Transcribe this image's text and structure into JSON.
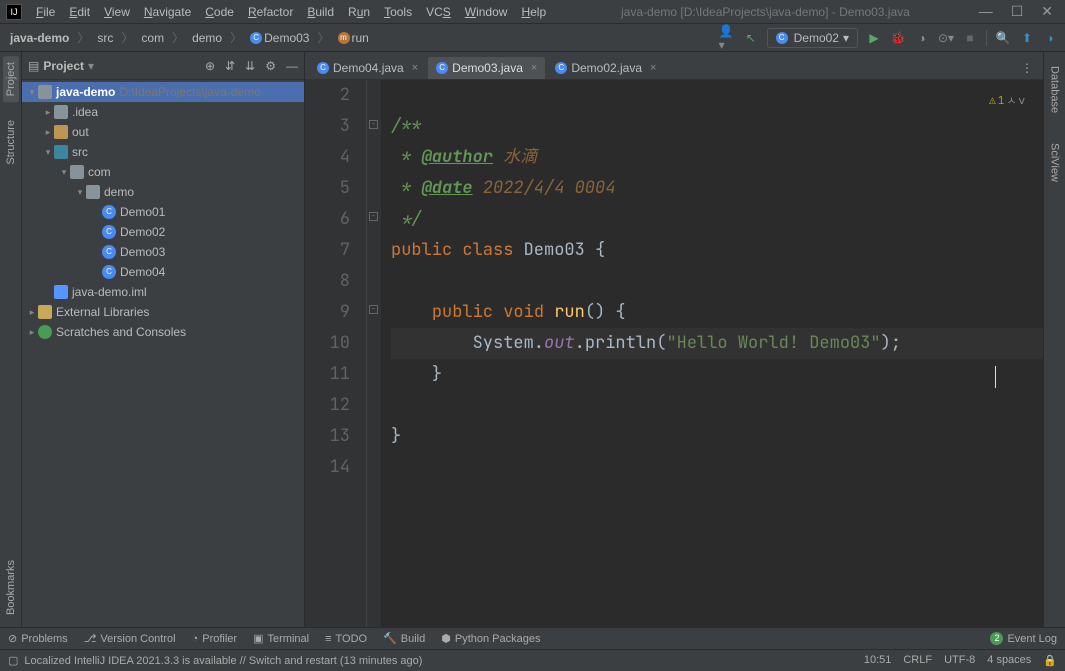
{
  "title": "java-demo [D:\\IdeaProjects\\java-demo] - Demo03.java",
  "menu": [
    "File",
    "Edit",
    "View",
    "Navigate",
    "Code",
    "Refactor",
    "Build",
    "Run",
    "Tools",
    "VCS",
    "Window",
    "Help"
  ],
  "breadcrumb": {
    "project": "java-demo",
    "p1": "src",
    "p2": "com",
    "p3": "demo",
    "cls": "Demo03",
    "method": "run"
  },
  "runConfig": "Demo02",
  "projectPanel": {
    "title": "Project",
    "rootHint": "D:\\IdeaProjects\\java-demo"
  },
  "tree": {
    "root": "java-demo",
    "idea": ".idea",
    "out": "out",
    "src": "src",
    "com": "com",
    "demo": "demo",
    "c1": "Demo01",
    "c2": "Demo02",
    "c3": "Demo03",
    "c4": "Demo04",
    "iml": "java-demo.iml",
    "libs": "External Libraries",
    "scratch": "Scratches and Consoles"
  },
  "tabs": {
    "t1": "Demo04.java",
    "t2": "Demo03.java",
    "t3": "Demo02.java"
  },
  "code": {
    "l3": "/**",
    "l4_pre": " * ",
    "l4_tag": "@author",
    "l4_val": " 水滴",
    "l5_pre": " * ",
    "l5_tag": "@date",
    "l5_val": " 2022/4/4 0004",
    "l6": " */",
    "l7_kw1": "public ",
    "l7_kw2": "class ",
    "l7_cls": "Demo03 ",
    "l7_b": "{",
    "l9_kw1": "public ",
    "l9_kw2": "void ",
    "l9_m": "run",
    "l9_p": "() {",
    "l10_a": "System.",
    "l10_b": "out",
    "l10_c": ".println(",
    "l10_s": "\"Hello World! Demo03\"",
    "l10_d": ");",
    "l11": "}",
    "l13": "}"
  },
  "lineNums": [
    "2",
    "3",
    "4",
    "5",
    "6",
    "7",
    "8",
    "9",
    "10",
    "11",
    "12",
    "13",
    "14"
  ],
  "warnCount": "1",
  "leftTabs": {
    "project": "Project",
    "structure": "Structure",
    "bookmarks": "Bookmarks"
  },
  "rightTabs": {
    "database": "Database",
    "sciview": "SciView"
  },
  "bottomTabs": {
    "problems": "Problems",
    "vcs": "Version Control",
    "profiler": "Profiler",
    "terminal": "Terminal",
    "todo": "TODO",
    "build": "Build",
    "python": "Python Packages",
    "eventLog": "Event Log",
    "eventBadge": "2"
  },
  "status": {
    "msg": "Localized IntelliJ IDEA 2021.3.3 is available // Switch and restart (13 minutes ago)",
    "time": "10:51",
    "eol": "CRLF",
    "enc": "UTF-8",
    "indent": "4 spaces"
  }
}
